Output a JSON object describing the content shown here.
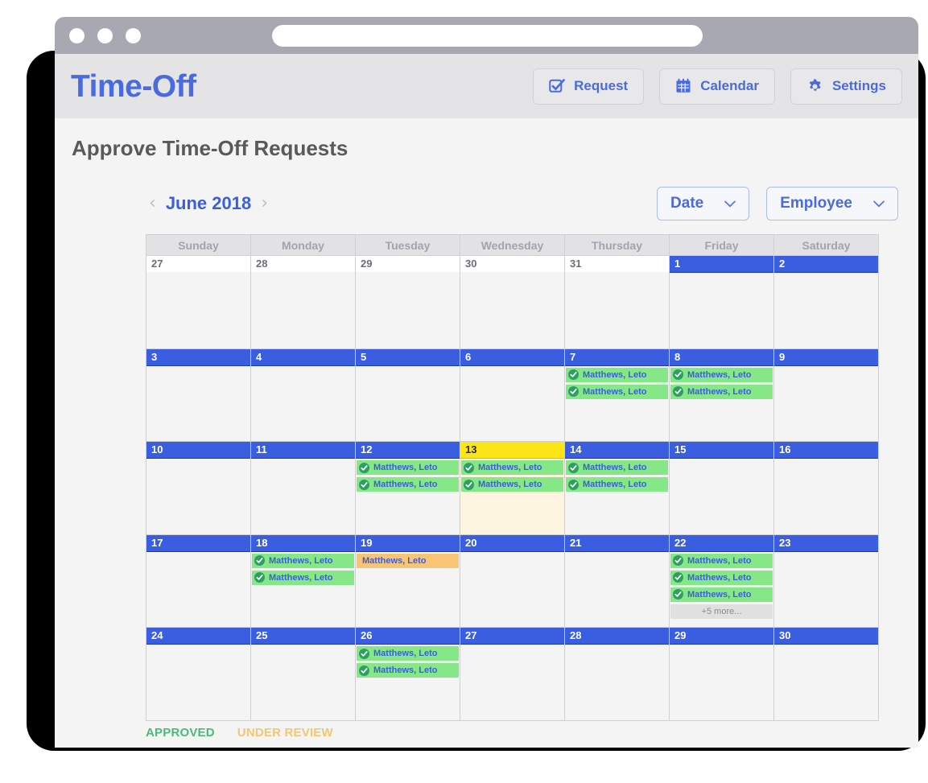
{
  "browser": {
    "dots": [
      "close-dot",
      "minimize-dot",
      "maximize-dot"
    ],
    "address_value": ""
  },
  "app": {
    "brand": "Time-Off",
    "page_title": "Approve Time-Off Requests",
    "header_buttons": [
      {
        "label": "Request",
        "icon": "checkbox-check-icon"
      },
      {
        "label": "Calendar",
        "icon": "calendar-icon"
      },
      {
        "label": "Settings",
        "icon": "gear-icon"
      }
    ]
  },
  "toolbar": {
    "prev_label": "‹",
    "next_label": "›",
    "month_label": "June 2018",
    "filters": [
      {
        "name": "date-filter",
        "label": "Date",
        "caret": "⌄"
      },
      {
        "name": "employee-filter",
        "label": "Employee",
        "caret": "⌄"
      }
    ]
  },
  "calendar": {
    "day_headers": [
      "Sunday",
      "Monday",
      "Tuesday",
      "Wednesday",
      "Thursday",
      "Friday",
      "Saturday"
    ],
    "more_label_template": "+5 more...",
    "weeks": [
      [
        {
          "num": "27",
          "in_month": false,
          "today": false,
          "events": []
        },
        {
          "num": "28",
          "in_month": false,
          "today": false,
          "events": []
        },
        {
          "num": "29",
          "in_month": false,
          "today": false,
          "events": []
        },
        {
          "num": "30",
          "in_month": false,
          "today": false,
          "events": []
        },
        {
          "num": "31",
          "in_month": false,
          "today": false,
          "events": []
        },
        {
          "num": "1",
          "in_month": true,
          "today": false,
          "events": []
        },
        {
          "num": "2",
          "in_month": true,
          "today": false,
          "events": []
        }
      ],
      [
        {
          "num": "3",
          "in_month": true,
          "today": false,
          "events": []
        },
        {
          "num": "4",
          "in_month": true,
          "today": false,
          "events": []
        },
        {
          "num": "5",
          "in_month": true,
          "today": false,
          "events": []
        },
        {
          "num": "6",
          "in_month": true,
          "today": false,
          "events": []
        },
        {
          "num": "7",
          "in_month": true,
          "today": false,
          "events": [
            {
              "label": "Matthews, Leto",
              "status": "approved"
            },
            {
              "label": "Matthews, Leto",
              "status": "approved"
            }
          ]
        },
        {
          "num": "8",
          "in_month": true,
          "today": false,
          "events": [
            {
              "label": "Matthews, Leto",
              "status": "approved"
            },
            {
              "label": "Matthews, Leto",
              "status": "approved"
            }
          ]
        },
        {
          "num": "9",
          "in_month": true,
          "today": false,
          "events": []
        }
      ],
      [
        {
          "num": "10",
          "in_month": true,
          "today": false,
          "events": []
        },
        {
          "num": "11",
          "in_month": true,
          "today": false,
          "events": []
        },
        {
          "num": "12",
          "in_month": true,
          "today": false,
          "events": [
            {
              "label": "Matthews, Leto",
              "status": "approved"
            },
            {
              "label": "Matthews, Leto",
              "status": "approved"
            }
          ]
        },
        {
          "num": "13",
          "in_month": true,
          "today": true,
          "events": [
            {
              "label": "Matthews, Leto",
              "status": "approved"
            },
            {
              "label": "Matthews, Leto",
              "status": "approved"
            }
          ]
        },
        {
          "num": "14",
          "in_month": true,
          "today": false,
          "events": [
            {
              "label": "Matthews, Leto",
              "status": "approved"
            },
            {
              "label": "Matthews, Leto",
              "status": "approved"
            }
          ]
        },
        {
          "num": "15",
          "in_month": true,
          "today": false,
          "events": []
        },
        {
          "num": "16",
          "in_month": true,
          "today": false,
          "events": []
        }
      ],
      [
        {
          "num": "17",
          "in_month": true,
          "today": false,
          "events": []
        },
        {
          "num": "18",
          "in_month": true,
          "today": false,
          "events": [
            {
              "label": "Matthews, Leto",
              "status": "approved"
            },
            {
              "label": "Matthews, Leto",
              "status": "approved"
            }
          ]
        },
        {
          "num": "19",
          "in_month": true,
          "today": false,
          "events": [
            {
              "label": "Matthews, Leto",
              "status": "review"
            }
          ]
        },
        {
          "num": "20",
          "in_month": true,
          "today": false,
          "events": []
        },
        {
          "num": "21",
          "in_month": true,
          "today": false,
          "events": []
        },
        {
          "num": "22",
          "in_month": true,
          "today": false,
          "events": [
            {
              "label": "Matthews, Leto",
              "status": "approved"
            },
            {
              "label": "Matthews, Leto",
              "status": "approved"
            },
            {
              "label": "Matthews, Leto",
              "status": "approved"
            },
            {
              "label": "+5 more...",
              "status": "more"
            }
          ]
        },
        {
          "num": "23",
          "in_month": true,
          "today": false,
          "events": []
        }
      ],
      [
        {
          "num": "24",
          "in_month": true,
          "today": false,
          "events": []
        },
        {
          "num": "25",
          "in_month": true,
          "today": false,
          "events": []
        },
        {
          "num": "26",
          "in_month": true,
          "today": false,
          "events": [
            {
              "label": "Matthews, Leto",
              "status": "approved"
            },
            {
              "label": "Matthews, Leto",
              "status": "approved"
            }
          ]
        },
        {
          "num": "27",
          "in_month": true,
          "today": false,
          "events": []
        },
        {
          "num": "28",
          "in_month": true,
          "today": false,
          "events": []
        },
        {
          "num": "29",
          "in_month": true,
          "today": false,
          "events": []
        },
        {
          "num": "30",
          "in_month": true,
          "today": false,
          "events": []
        }
      ]
    ]
  },
  "legend": [
    {
      "label": "APPROVED",
      "status": "approved"
    },
    {
      "label": "UNDER REVIEW",
      "status": "review"
    }
  ],
  "colors": {
    "brand_blue": "#4a6ae0",
    "day_blue": "#3b5ee0",
    "today_yellow": "#fbe516",
    "today_bg": "#fdf5e0",
    "approved_green": "#85e786",
    "approved_badge": "#2f9e63",
    "review_orange": "#f9c473",
    "more_gray": "#e0e0e0",
    "legend_approved": "#4cb87c",
    "legend_review": "#f5c572",
    "titlebar": "#a8a8b3"
  }
}
